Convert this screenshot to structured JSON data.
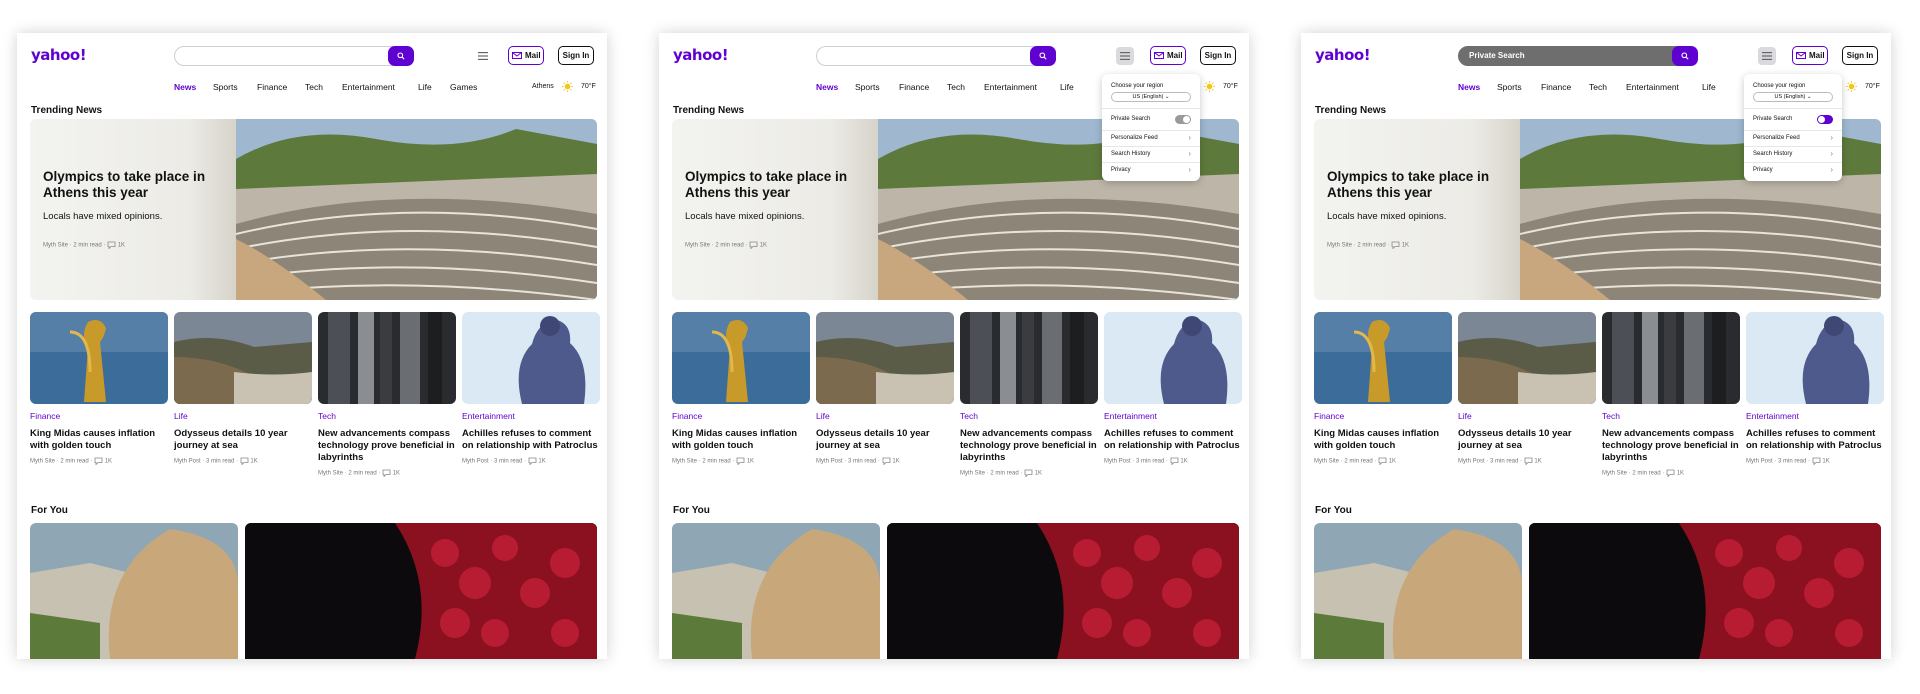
{
  "logo": "yahoo!",
  "header": {
    "search_value": "Private Search",
    "mail_label": "Mail",
    "signin_label": "Sign In"
  },
  "nav": [
    "News",
    "Sports",
    "Finance",
    "Tech",
    "Entertainment",
    "Life",
    "Games"
  ],
  "nav_short": [
    "News",
    "Sports",
    "Finance",
    "Tech",
    "Entertainment",
    "Life"
  ],
  "weather": {
    "city": "Athens",
    "temp": "70°F"
  },
  "sections": {
    "trending": "Trending News",
    "for_you": "For You"
  },
  "hero": {
    "title": "Olympics to take place in Athens this year",
    "subtitle": "Locals have mixed opinions.",
    "meta": "Myth Site · 2 min read ·",
    "comments": "1K"
  },
  "cards": [
    {
      "category": "Finance",
      "title": "King Midas causes inflation with golden touch",
      "meta": "Myth Site · 2 min read ·",
      "comments": "1K"
    },
    {
      "category": "Life",
      "title": "Odysseus details 10 year journey at sea",
      "meta": "Myth Post · 3 min read ·",
      "comments": "1K"
    },
    {
      "category": "Tech",
      "title": "New advancements compass technology prove beneficial in labyrinths",
      "meta": "Myth Site · 2 min read ·",
      "comments": "1K"
    },
    {
      "category": "Entertainment",
      "title": "Achilles refuses to comment on relationship with Patroclus",
      "meta": "Myth Post · 3 min read ·",
      "comments": "1K"
    }
  ],
  "dropdown": {
    "region_label": "Choose your region",
    "region_value": "US (English)",
    "private_search": "Private Search",
    "personalize": "Personalize Feed",
    "history": "Search History",
    "privacy": "Privacy"
  },
  "states": {
    "frame1": {
      "menu_open": false,
      "private_search_on": false
    },
    "frame2": {
      "menu_open": true,
      "private_search_on": false
    },
    "frame3": {
      "menu_open": true,
      "private_search_on": true
    }
  },
  "colors": {
    "accent": "#5f01d1",
    "text": "#111111",
    "meta": "#777777",
    "toggle_off": "#9a9a9a"
  }
}
